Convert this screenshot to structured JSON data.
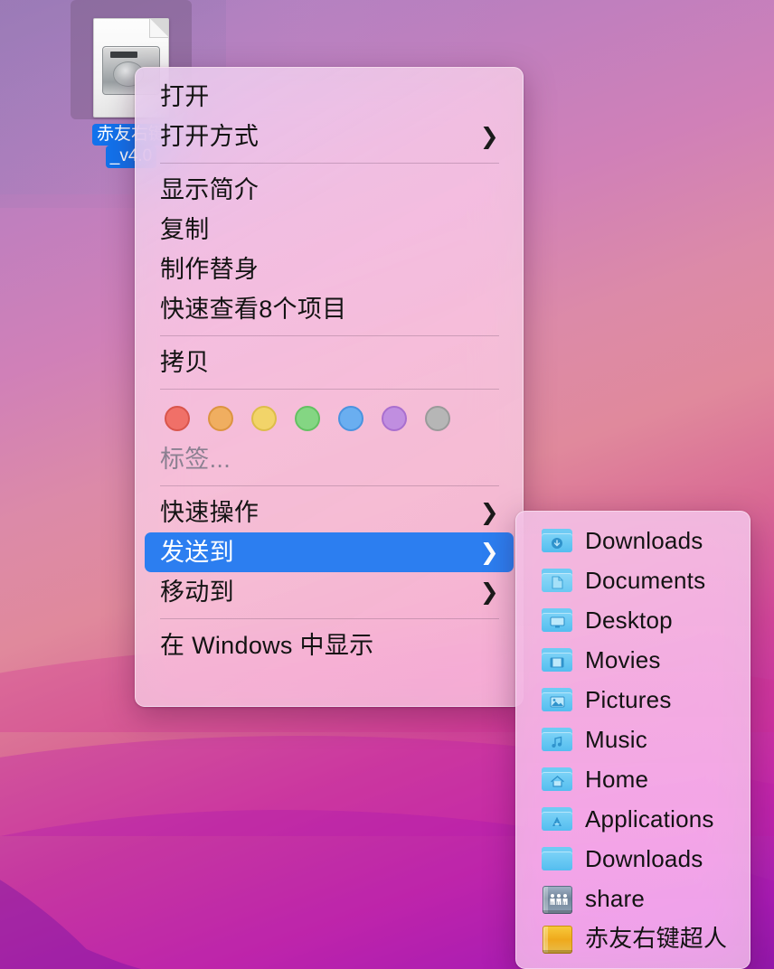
{
  "desktop": {
    "file_icon": {
      "icon": "disk-image-document-icon",
      "label_line1": "赤友右键",
      "label_line2": "_v4.0",
      "selected": true
    }
  },
  "context_menu": {
    "groups": [
      {
        "items": [
          {
            "label": "打开",
            "submenu": false,
            "name": "open"
          },
          {
            "label": "打开方式",
            "submenu": true,
            "name": "open-with"
          }
        ]
      },
      {
        "items": [
          {
            "label": "显示简介",
            "submenu": false,
            "name": "get-info"
          },
          {
            "label": "复制",
            "submenu": false,
            "name": "duplicate"
          },
          {
            "label": "制作替身",
            "submenu": false,
            "name": "make-alias"
          },
          {
            "label": "快速查看8个项目",
            "submenu": false,
            "name": "quick-look"
          }
        ]
      },
      {
        "items": [
          {
            "label": "拷贝",
            "submenu": false,
            "name": "copy"
          }
        ]
      },
      {
        "tags": [
          {
            "name": "tag-red",
            "color": "#f07068",
            "border": "#d9554c"
          },
          {
            "name": "tag-orange",
            "color": "#f0ae60",
            "border": "#dc9440"
          },
          {
            "name": "tag-yellow",
            "color": "#f2d469",
            "border": "#ddbd49"
          },
          {
            "name": "tag-green",
            "color": "#84d683",
            "border": "#63c162"
          },
          {
            "name": "tag-blue",
            "color": "#6aaef0",
            "border": "#4a93df"
          },
          {
            "name": "tag-purple",
            "color": "#c08ee0",
            "border": "#a96fcf"
          },
          {
            "name": "tag-gray",
            "color": "#b6b6b6",
            "border": "#9a9a9a"
          }
        ],
        "tags_placeholder": "标签..."
      },
      {
        "items": [
          {
            "label": "快速操作",
            "submenu": true,
            "name": "quick-actions"
          },
          {
            "label": "发送到",
            "submenu": true,
            "name": "send-to",
            "selected": true
          },
          {
            "label": "移动到",
            "submenu": true,
            "name": "move-to"
          }
        ]
      },
      {
        "items": [
          {
            "label": "在 Windows 中显示",
            "submenu": false,
            "name": "show-in-windows"
          }
        ]
      }
    ],
    "chevron": "❯",
    "highlight_color": "#2c7ef0"
  },
  "submenu": {
    "parent": "发送到",
    "items": [
      {
        "label": "Downloads",
        "icon": "folder-downloads-icon",
        "type": "folder",
        "glyph": "download"
      },
      {
        "label": "Documents",
        "icon": "folder-documents-icon",
        "type": "folder",
        "glyph": "document"
      },
      {
        "label": "Desktop",
        "icon": "folder-desktop-icon",
        "type": "folder",
        "glyph": "desktop"
      },
      {
        "label": "Movies",
        "icon": "folder-movies-icon",
        "type": "folder",
        "glyph": "film"
      },
      {
        "label": "Pictures",
        "icon": "folder-pictures-icon",
        "type": "folder",
        "glyph": "photo"
      },
      {
        "label": "Music",
        "icon": "folder-music-icon",
        "type": "folder",
        "glyph": "note"
      },
      {
        "label": "Home",
        "icon": "folder-home-icon",
        "type": "folder",
        "glyph": "house"
      },
      {
        "label": "Applications",
        "icon": "folder-applications-icon",
        "type": "folder",
        "glyph": "appstore"
      },
      {
        "label": "Downloads",
        "icon": "folder-plain-icon",
        "type": "folder",
        "glyph": "none"
      },
      {
        "label": "share",
        "icon": "drive-share-icon",
        "type": "drive-share",
        "glyph": "people"
      },
      {
        "label": "赤友右键超人",
        "icon": "drive-orange-icon",
        "type": "drive-orange",
        "glyph": "none"
      }
    ]
  }
}
